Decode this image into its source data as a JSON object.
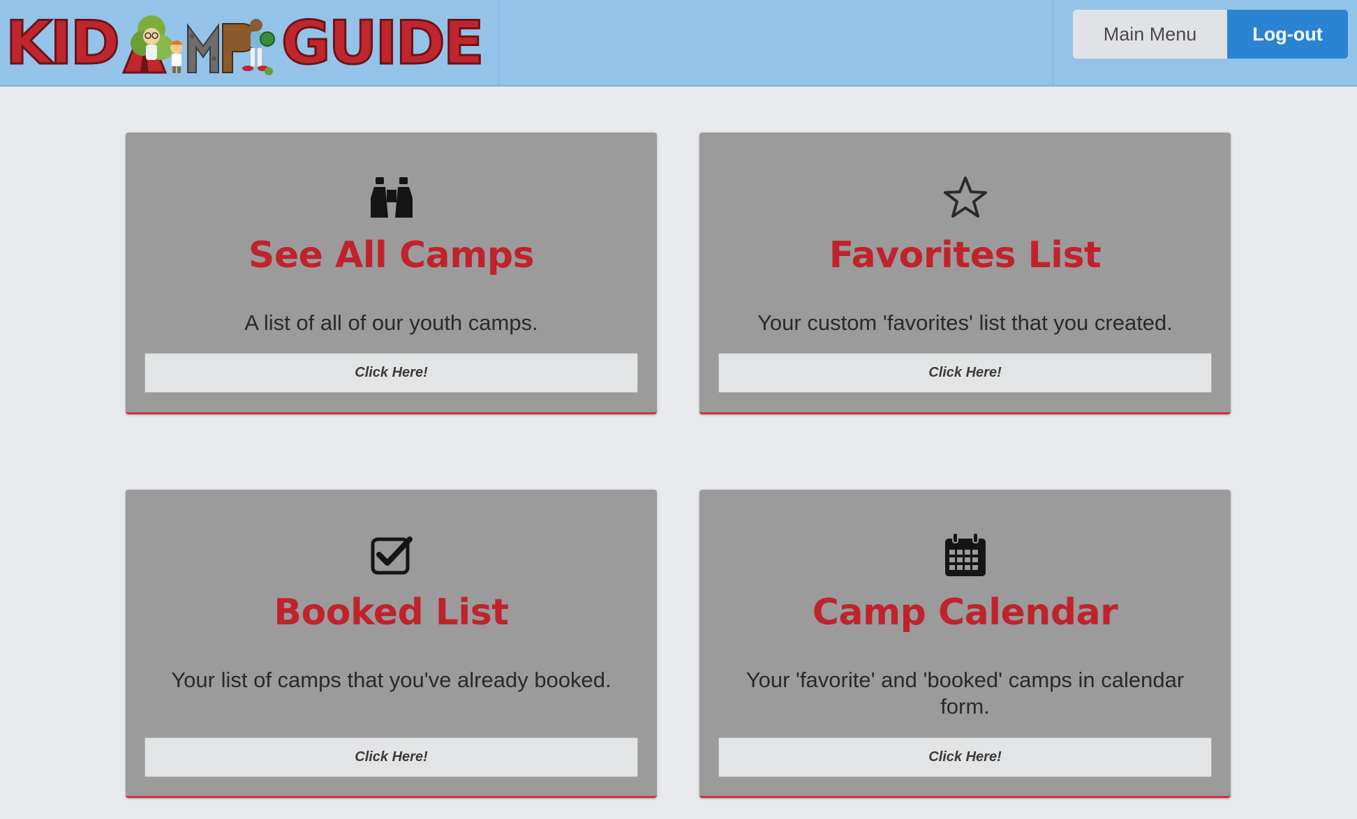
{
  "header": {
    "logo_text_left": "KID",
    "logo_text_right": "GUIDE",
    "main_menu_label": "Main Menu",
    "logout_label": "Log-out"
  },
  "colors": {
    "header_bg": "#94c3e9",
    "card_bg": "#9b9b9c",
    "title_red": "#c0232b",
    "logout_blue": "#2a84d2",
    "page_bg": "#e8e9ec"
  },
  "cards": [
    {
      "icon": "binoculars-icon",
      "title": "See All Camps",
      "description": "A list of all of our youth camps.",
      "button_label": "Click Here!"
    },
    {
      "icon": "star-outline-icon",
      "title": "Favorites List",
      "description": "Your custom 'favorites' list that you created.",
      "button_label": "Click Here!"
    },
    {
      "icon": "checkbox-checked-icon",
      "title": "Booked List",
      "description": "Your list of camps that you've already booked.",
      "button_label": "Click Here!"
    },
    {
      "icon": "calendar-icon",
      "title": "Camp Calendar",
      "description": "Your 'favorite' and 'booked' camps in calendar form.",
      "button_label": "Click Here!"
    }
  ]
}
